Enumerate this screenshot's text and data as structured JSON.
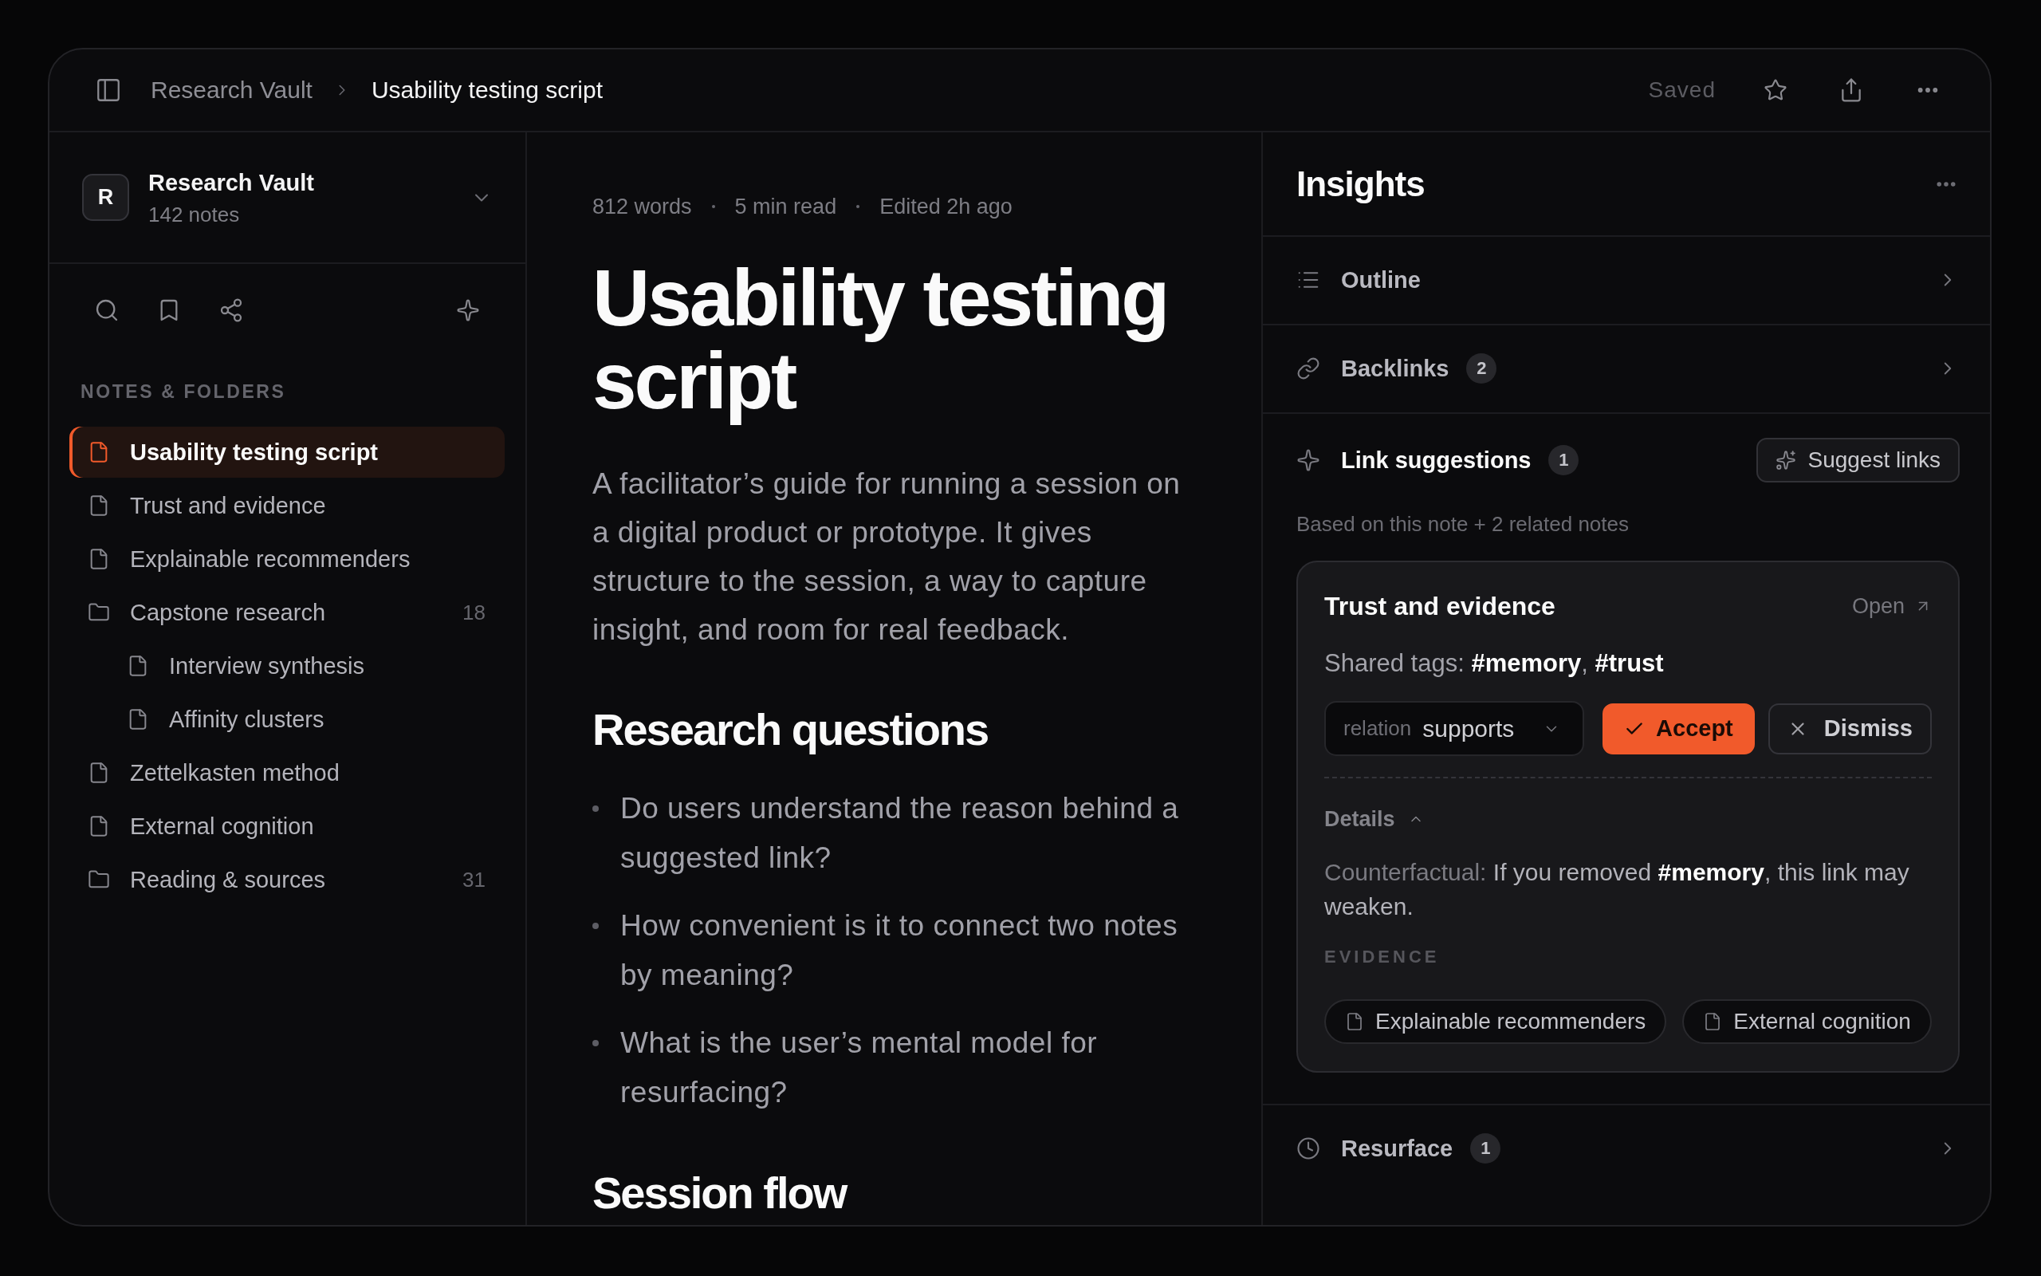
{
  "topbar": {
    "breadcrumbs": [
      {
        "label": "Research Vault",
        "current": false
      },
      {
        "label": "Usability testing script",
        "current": true
      }
    ],
    "status": "Saved"
  },
  "sidebar": {
    "vault": {
      "avatar": "R",
      "name": "Research Vault",
      "count": "142 notes"
    },
    "section_label": "NOTES & FOLDERS",
    "items": [
      {
        "kind": "note",
        "label": "Usability testing script",
        "selected": true
      },
      {
        "kind": "note",
        "label": "Trust and evidence",
        "selected": false
      },
      {
        "kind": "note",
        "label": "Explainable recommenders",
        "selected": false
      },
      {
        "kind": "folder",
        "label": "Capstone research",
        "count": "18",
        "selected": false,
        "children": [
          {
            "kind": "note",
            "label": "Interview synthesis",
            "selected": false
          },
          {
            "kind": "note",
            "label": "Affinity clusters",
            "selected": false
          }
        ]
      },
      {
        "kind": "note",
        "label": "Zettelkasten method",
        "selected": false
      },
      {
        "kind": "note",
        "label": "External cognition",
        "selected": false
      },
      {
        "kind": "folder",
        "label": "Reading & sources",
        "count": "31",
        "selected": false
      }
    ]
  },
  "editor": {
    "meta": [
      "812 words",
      "5 min read",
      "Edited 2h ago"
    ],
    "title": "Usability testing script",
    "lead": "A facilitator’s guide for running a session on a digital product or prototype. It gives structure to the session, a way to capture insight, and room for real feedback.",
    "sections": [
      {
        "heading": "Research questions",
        "bullets": [
          "Do users understand the reason behind a suggested link?",
          "How convenient is it to connect two notes by meaning?",
          "What is the user’s mental model for resurfacing?"
        ]
      },
      {
        "heading": "Session flow"
      }
    ]
  },
  "insights": {
    "title": "Insights",
    "panels": [
      {
        "kind": "outline",
        "label": "Outline",
        "expanded": false
      },
      {
        "kind": "backlinks",
        "label": "Backlinks",
        "count": "2",
        "expanded": false
      },
      {
        "kind": "suggestions",
        "label": "Link suggestions",
        "count": "1",
        "expanded": true,
        "action": "Suggest links",
        "note": "Based on this note + 2 related notes",
        "suggestion": {
          "title": "Trust and evidence",
          "open": "Open",
          "tags": "Shared tags: **#memory**, **#trust**",
          "relation": {
            "label": "relation",
            "value": "supports"
          },
          "actions": [
            {
              "kind": "accept",
              "label": "Accept"
            },
            {
              "kind": "dismiss",
              "label": "Dismiss"
            }
          ],
          "details": {
            "label": "Details",
            "expanded": true,
            "counterfactual": {
              "label": "Counterfactual:",
              "text": "If you removed **#memory**, this link may weaken."
            },
            "evidence_label": "EVIDENCE",
            "evidence": [
              "Explainable recommenders",
              "External cognition"
            ]
          }
        }
      },
      {
        "kind": "resurface",
        "label": "Resurface",
        "count": "1",
        "expanded": false
      }
    ]
  }
}
